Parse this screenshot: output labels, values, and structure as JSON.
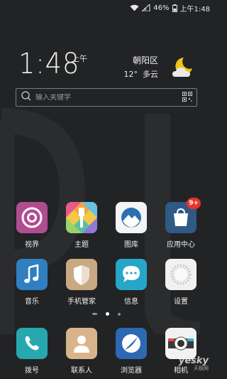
{
  "status_bar": {
    "battery_percent": "46%",
    "time": "上午1:48"
  },
  "clock": {
    "time": "1:48",
    "ampm": "上午"
  },
  "weather": {
    "city": "朝阳区",
    "temp": "12°",
    "condition": "多云",
    "icon": "moon-cloud-icon"
  },
  "search": {
    "placeholder": "输入关键字"
  },
  "apps_row1": [
    {
      "label": "视界"
    },
    {
      "label": "主题"
    },
    {
      "label": "图库"
    },
    {
      "label": "应用中心",
      "badge": "9+"
    }
  ],
  "apps_row2": [
    {
      "label": "音乐"
    },
    {
      "label": "手机管家"
    },
    {
      "label": "信息"
    },
    {
      "label": "设置"
    }
  ],
  "dock": [
    {
      "label": "拨号"
    },
    {
      "label": "联系人"
    },
    {
      "label": "浏览器"
    },
    {
      "label": "相机"
    }
  ],
  "page_indicator": {
    "pages": 3,
    "current": 2
  },
  "watermark": {
    "brand": "yesky",
    "sub": "天极网"
  },
  "colors": {
    "background": "#222325",
    "badge": "#e8322e"
  }
}
